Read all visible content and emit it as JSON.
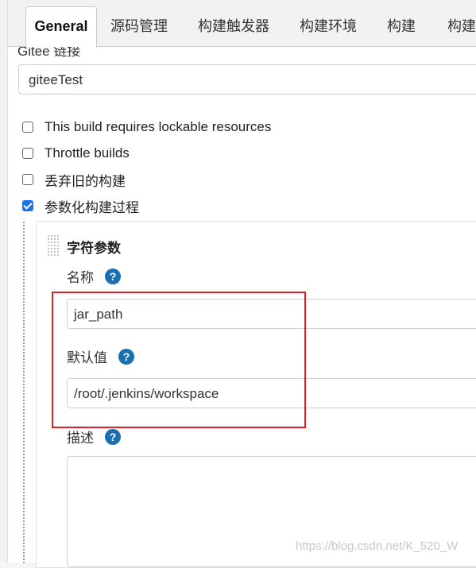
{
  "tabs": [
    {
      "label": "General",
      "active": true
    },
    {
      "label": "源码管理"
    },
    {
      "label": "构建触发器"
    },
    {
      "label": "构建环境"
    },
    {
      "label": "构建"
    },
    {
      "label": "构建后"
    }
  ],
  "gitee": {
    "label": "Gitee 链接",
    "value": "giteeTest"
  },
  "options": [
    {
      "label": "This build requires lockable resources",
      "checked": false
    },
    {
      "label": "Throttle builds",
      "checked": false
    },
    {
      "label": "丢弃旧的构建",
      "checked": false
    },
    {
      "label": "参数化构建过程",
      "checked": true
    }
  ],
  "param": {
    "title": "字符参数",
    "name_label": "名称",
    "name_value": "jar_path",
    "default_label": "默认值",
    "default_value": "/root/.jenkins/workspace",
    "desc_label": "描述",
    "desc_value": ""
  },
  "help_glyph": "?",
  "watermark": "https://blog.csdn.net/K_520_W",
  "colors": {
    "highlight": "#e02020",
    "help": "#1a6fb0",
    "check": "#1a73e8"
  }
}
